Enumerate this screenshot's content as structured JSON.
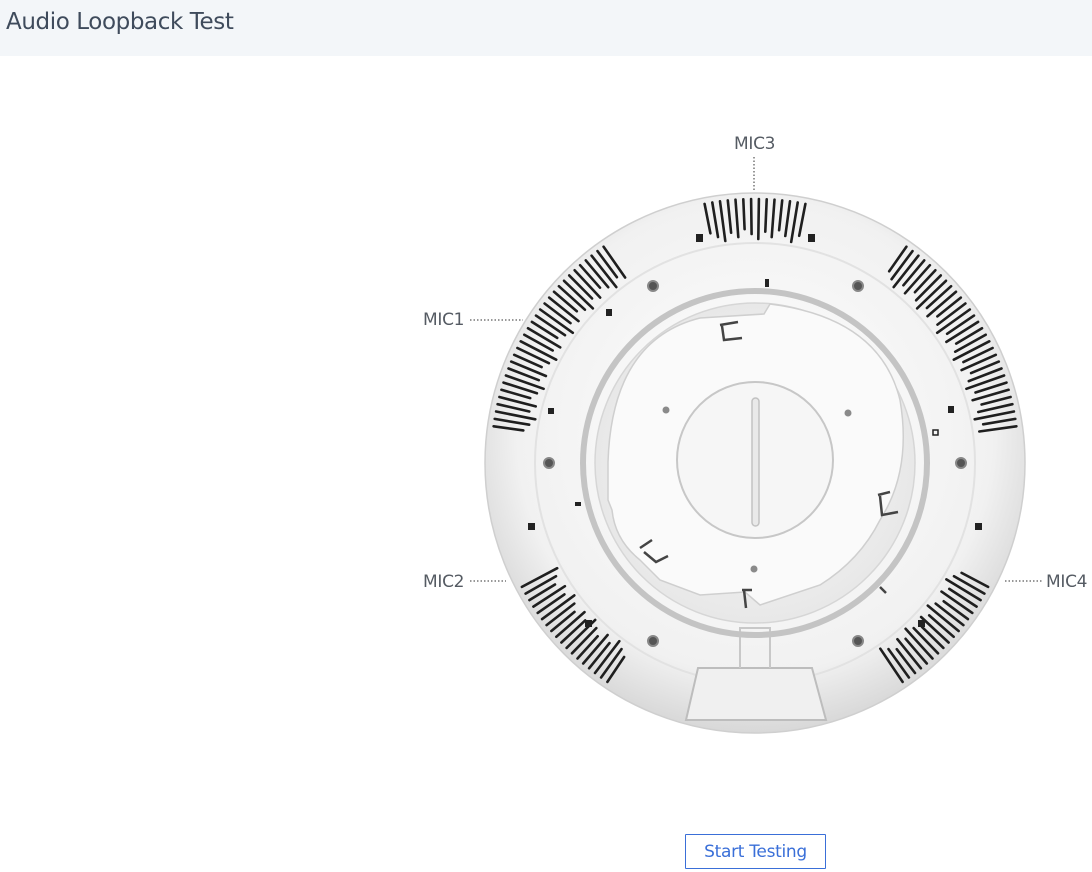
{
  "page": {
    "title": "Audio Loopback Test"
  },
  "device": {
    "mic_labels": {
      "mic1": "MIC1",
      "mic2": "MIC2",
      "mic3": "MIC3",
      "mic4": "MIC4"
    }
  },
  "actions": {
    "start_label": "Start Testing"
  },
  "colors": {
    "accent": "#3a6fd8",
    "header_bg": "#f3f6f9",
    "title_text": "#3f4b5c"
  }
}
